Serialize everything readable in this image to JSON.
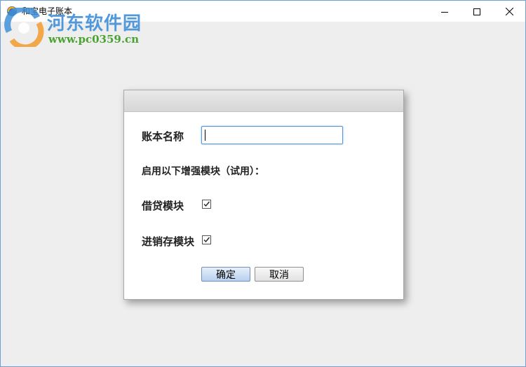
{
  "window": {
    "title": "和宝电子账本",
    "accent_color": "#6f9fd8",
    "controls": {
      "minimize_icon": "minimize-icon",
      "maximize_icon": "maximize-icon",
      "close_icon": "close-icon"
    }
  },
  "watermark": {
    "title": "河东软件园",
    "url": "www.pc0359.cn"
  },
  "dialog": {
    "account_name_label": "账本名称",
    "account_name_value": "",
    "enhance_modules_label": "启用以下增强模块（试用）：",
    "modules": [
      {
        "label": "借贷模块",
        "checked": true
      },
      {
        "label": "进销存模块",
        "checked": true
      }
    ],
    "ok_label": "确定",
    "cancel_label": "取消"
  }
}
